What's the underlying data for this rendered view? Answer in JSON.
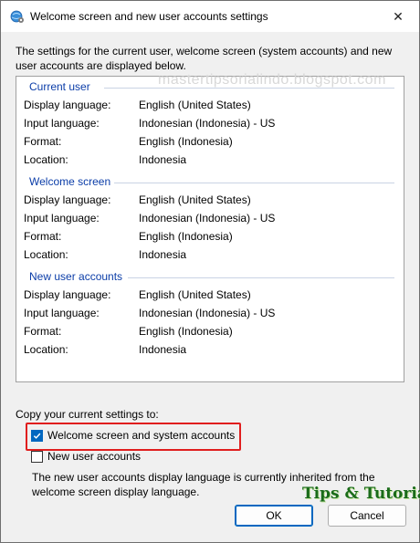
{
  "window": {
    "title": "Welcome screen and new user accounts settings",
    "close_glyph": "✕"
  },
  "intro": {
    "line1": "The settings for the current user, welcome screen (system accounts) and new",
    "line2": "user accounts are displayed below."
  },
  "watermark": "mastertipsorialindo.blogspot.com",
  "labels": {
    "display_language": "Display language:",
    "input_language": "Input language:",
    "format": "Format:",
    "location": "Location:"
  },
  "sections": {
    "current_user": {
      "header": "Current user",
      "display_language": "English (United States)",
      "input_language": "Indonesian (Indonesia) - US",
      "format": "English (Indonesia)",
      "location": "Indonesia"
    },
    "welcome_screen": {
      "header": "Welcome screen",
      "display_language": "English (United States)",
      "input_language": "Indonesian (Indonesia) - US",
      "format": "English (Indonesia)",
      "location": "Indonesia"
    },
    "new_user_accounts": {
      "header": "New user accounts",
      "display_language": "English (United States)",
      "input_language": "Indonesian (Indonesia) - US",
      "format": "English (Indonesia)",
      "location": "Indonesia"
    }
  },
  "copy": {
    "label": "Copy your current settings to:",
    "welcome_checkbox": {
      "label": "Welcome screen and system accounts",
      "checked": true
    },
    "new_users_checkbox": {
      "label": "New user accounts",
      "checked": false
    }
  },
  "note": {
    "line1": "The new user accounts display language is currently inherited from the",
    "line2": "welcome screen display language."
  },
  "buttons": {
    "ok": "OK",
    "cancel": "Cancel"
  },
  "logo_text": "Tips & Tutorial",
  "colors": {
    "accent": "#0067c0",
    "section_header": "#0b3da8",
    "highlight": "#e01e1e"
  },
  "icons": {
    "title": "globe-settings-icon",
    "close": "close-icon",
    "check": "checkmark-icon"
  }
}
